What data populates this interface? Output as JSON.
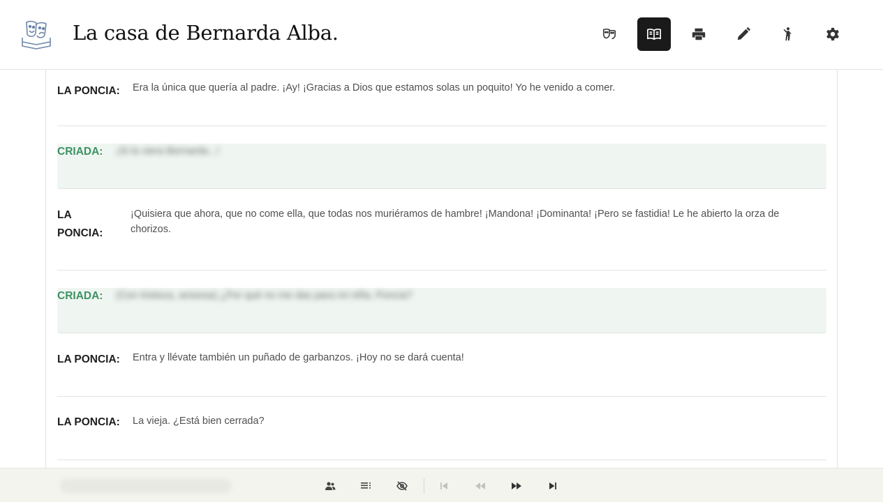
{
  "app": {
    "title": "La casa de Bernarda Alba."
  },
  "toolbar": {
    "items": [
      {
        "name": "theater-masks-icon",
        "active": false
      },
      {
        "name": "open-book-icon",
        "active": true
      },
      {
        "name": "printer-icon",
        "active": false
      },
      {
        "name": "pencil-icon",
        "active": false
      },
      {
        "name": "actor-icon",
        "active": false
      },
      {
        "name": "gear-icon",
        "active": false
      }
    ]
  },
  "script": {
    "lines": [
      {
        "speaker": "LA PONCIA:",
        "text": "Era la única que quería al padre. ¡Ay! ¡Gracias a Dios que estamos solas un poquito! Yo he venido a comer."
      },
      {
        "speaker": "CRIADA:",
        "text": "¡Si la viera Bernarda...!"
      },
      {
        "speaker": "LA PONCIA:",
        "text": "¡Quisiera que ahora, que no come ella, que todas nos muriéramos de hambre! ¡Mandona! ¡Dominanta! ¡Pero se fastidia! Le he abierto la orza de chorizos."
      },
      {
        "speaker": "CRIADA:",
        "text": "(Con tristeza, ansiosa) ¿Por qué no me das para mi niña, Poncia?"
      },
      {
        "speaker": "LA PONCIA:",
        "text": "Entra y llévate también un puñado de garbanzos. ¡Hoy no se dará cuenta!"
      },
      {
        "speaker": "LA PONCIA:",
        "text": "La vieja. ¿Está bien cerrada?"
      }
    ]
  },
  "controls": {
    "items": [
      "characters-icon",
      "list-icon",
      "eye-off-icon",
      "skip-start-icon",
      "rewind-icon",
      "fast-forward-icon",
      "skip-end-icon"
    ]
  },
  "colors": {
    "accent": "#3e9163",
    "criada_bg": "#eff6f2",
    "active_tool": "#1a1a1a",
    "bottom_bar": "#f4f4ee"
  }
}
